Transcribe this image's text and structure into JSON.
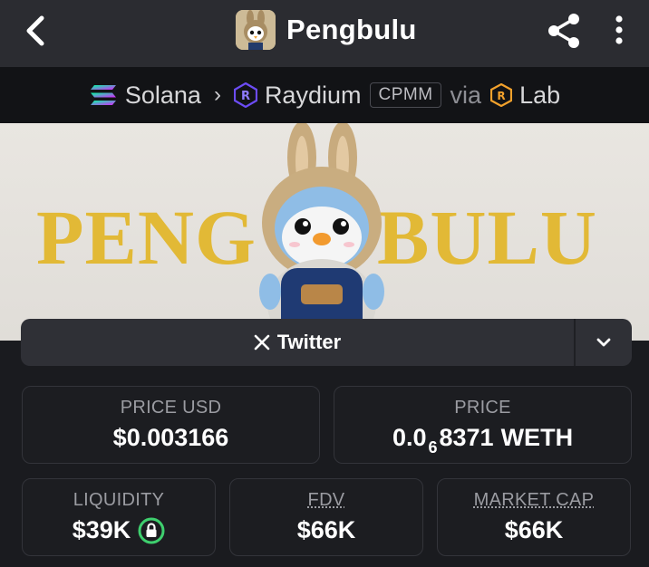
{
  "header": {
    "title": "Pengbulu",
    "back_icon": "chevron-left-icon",
    "share_icon": "share-icon",
    "more_icon": "more-vertical-icon"
  },
  "breadcrumb": {
    "chain": "Solana",
    "dex": "Raydium",
    "pool_type": "CPMM",
    "via": "via",
    "launchpad": "Lab"
  },
  "banner": {
    "left_text": "PENG",
    "right_text": "BULU"
  },
  "socials": {
    "twitter_label": "Twitter"
  },
  "stats": {
    "price_usd": {
      "label": "PRICE USD",
      "value": "$0.003166"
    },
    "price": {
      "label": "PRICE",
      "prefix": "0.0",
      "zeros": "6",
      "digits": "8371",
      "unit": "WETH"
    },
    "liquidity": {
      "label": "LIQUIDITY",
      "value": "$39K"
    },
    "fdv": {
      "label": "FDV",
      "value": "$66K"
    },
    "market_cap": {
      "label": "MARKET CAP",
      "value": "$66K"
    }
  },
  "colors": {
    "banner_gold": "#e2b936",
    "lock_green": "#3ecf6e",
    "raydium_purple": "#6c4cf5",
    "lab_orange": "#f2a12c"
  }
}
